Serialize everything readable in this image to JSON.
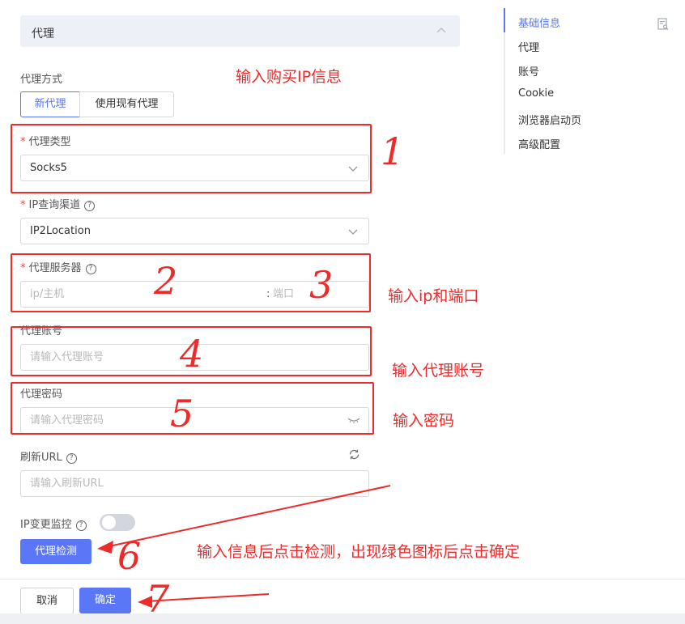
{
  "section": {
    "title": "代理"
  },
  "proxy_mode": {
    "label": "代理方式",
    "options": [
      "新代理",
      "使用现有代理"
    ],
    "selected": "新代理"
  },
  "proxy_type": {
    "label": "代理类型",
    "value": "Socks5"
  },
  "ip_channel": {
    "label": "IP查询渠道",
    "value": "IP2Location"
  },
  "proxy_server": {
    "label": "代理服务器",
    "host_placeholder": "ip/主机",
    "port_placeholder": "端口",
    "separator": ":"
  },
  "proxy_account": {
    "label": "代理账号",
    "placeholder": "请输入代理账号"
  },
  "proxy_password": {
    "label": "代理密码",
    "placeholder": "请输入代理密码"
  },
  "refresh_url": {
    "label": "刷新URL",
    "placeholder": "请输入刷新URL"
  },
  "ip_monitor": {
    "label": "IP变更监控",
    "enabled": false
  },
  "check_button": "代理检测",
  "footer": {
    "cancel": "取消",
    "ok": "确定"
  },
  "nav": [
    "基础信息",
    "代理",
    "账号",
    "Cookie",
    "浏览器启动页",
    "高级配置"
  ],
  "annotations": {
    "buy_ip": "输入购买IP信息",
    "ip_port": "输入ip和端口",
    "account": "输入代理账号",
    "password": "输入密码",
    "check": "输入信息后点击检测，出现绿色图标后点击确定",
    "digits": [
      "1",
      "2",
      "3",
      "4",
      "5",
      "6",
      "7"
    ]
  },
  "colors": {
    "accent": "#5a77f7",
    "annotation_red": "#ee2a2a",
    "required": "#f04848"
  }
}
